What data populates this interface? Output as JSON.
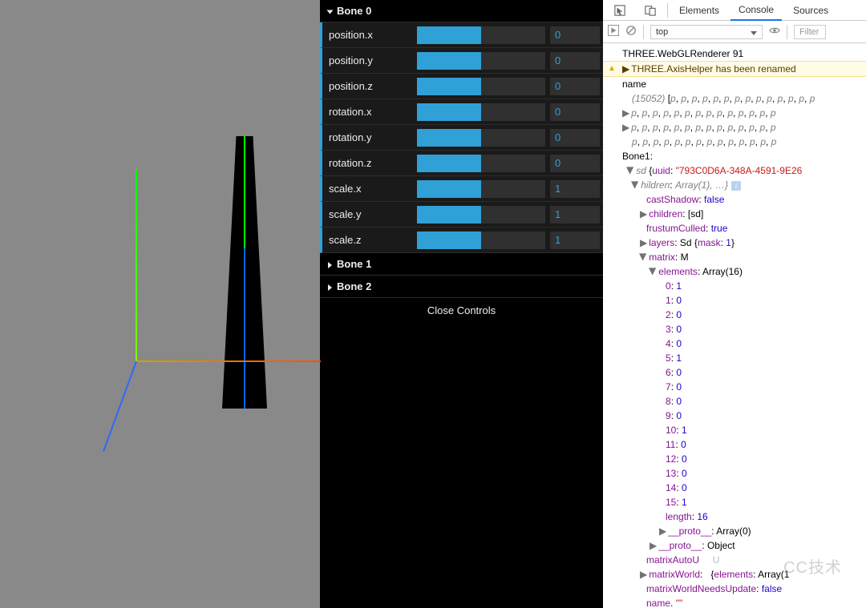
{
  "gui": {
    "folders": [
      {
        "title": "Bone 0",
        "open": true,
        "props": [
          {
            "label": "position.x",
            "value": "0",
            "fill": 50
          },
          {
            "label": "position.y",
            "value": "0",
            "fill": 50
          },
          {
            "label": "position.z",
            "value": "0",
            "fill": 50
          },
          {
            "label": "rotation.x",
            "value": "0",
            "fill": 50
          },
          {
            "label": "rotation.y",
            "value": "0",
            "fill": 50
          },
          {
            "label": "rotation.z",
            "value": "0",
            "fill": 50
          },
          {
            "label": "scale.x",
            "value": "1",
            "fill": 50
          },
          {
            "label": "scale.y",
            "value": "1",
            "fill": 50
          },
          {
            "label": "scale.z",
            "value": "1",
            "fill": 50
          }
        ]
      },
      {
        "title": "Bone 1",
        "open": false,
        "props": []
      },
      {
        "title": "Bone 2",
        "open": false,
        "props": []
      }
    ],
    "close_label": "Close Controls"
  },
  "devtools": {
    "tabs": {
      "elements": "Elements",
      "console": "Console",
      "sources": "Sources"
    },
    "toolbar": {
      "context": "top",
      "filter_placeholder": "Filter"
    },
    "console": {
      "line_renderer": "THREE.WebGLRenderer 91",
      "line_warn": "THREE.AxisHelper has been renamed ",
      "name_lbl": "name",
      "arr_count": "(15052)",
      "p_token": "p",
      "bone1_lbl": "Bone1:",
      "sd_lbl": "sd",
      "uuid_key": "uuid",
      "uuid_val": "\"793C0D6A-348A-4591-9E26",
      "hildren_lbl": "hildren",
      "hildren_val": "Array(1), …}",
      "castShadow": {
        "k": "castShadow",
        "v": "false"
      },
      "children": {
        "k": "children",
        "v": "[sd]"
      },
      "frustumCulled": {
        "k": "frustumCulled",
        "v": "true"
      },
      "layers": {
        "k": "layers",
        "v": "Sd",
        "mask_k": "mask",
        "mask_v": "1"
      },
      "matrix": {
        "k": "matrix",
        "v": "M"
      },
      "elements": {
        "k": "elements",
        "v": "Array(16)"
      },
      "matrix_values": [
        "1",
        "0",
        "0",
        "0",
        "0",
        "1",
        "0",
        "0",
        "0",
        "0",
        "1",
        "0",
        "0",
        "0",
        "0",
        "1"
      ],
      "length": {
        "k": "length",
        "v": "16"
      },
      "proto_arr": {
        "k": "__proto__",
        "v": "Array(0)"
      },
      "proto_obj": {
        "k": "__proto__",
        "v": "Object"
      },
      "matrixAutoU": "matrixAutoU",
      "matrixWorld": {
        "k": "matrixWorld",
        "pre": "",
        "elkey": "elements",
        "elval": "Array(1"
      },
      "matrixWorldNeedsUpdate": {
        "k": "matrixWorldNeedsUpdate",
        "v": "false"
      }
    }
  },
  "watermark": "CC技术"
}
